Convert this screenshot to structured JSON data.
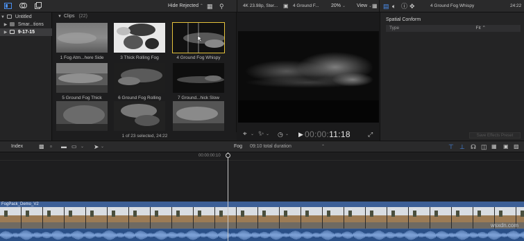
{
  "toolbar": {
    "hide_rejected": "Hide Rejected",
    "format_info": "4K 23.98p, Ster...",
    "project_clip": "4 Ground F...",
    "zoom": "20%",
    "view": "View",
    "inspector_clip": "4 Ground Fog Whispy",
    "inspector_duration": "24:22"
  },
  "libraries": {
    "items": [
      {
        "label": "Untitled",
        "expanded": true
      },
      {
        "label": "Smar...tions",
        "expanded": false
      },
      {
        "label": "9-17-15",
        "expanded": false,
        "selected": true
      }
    ]
  },
  "browser": {
    "title": "Clips",
    "count": "(22)",
    "clips": [
      {
        "label": "1 Fog Atm...here Side"
      },
      {
        "label": "3 Thick Rolling Fog"
      },
      {
        "label": "4 Ground Fog Whispy",
        "selected": true
      },
      {
        "label": "5 Ground Fog Thick"
      },
      {
        "label": "6 Ground Fog Rolling"
      },
      {
        "label": "7 Ground...hick Slow"
      },
      {
        "label": ""
      },
      {
        "label": ""
      },
      {
        "label": ""
      }
    ],
    "status": "1 of 23 selected, 24:22"
  },
  "viewer": {
    "timecode_dim": "00:00:",
    "timecode_lit": "11:18"
  },
  "inspector": {
    "section": "Spatial Conform",
    "row_label": "Type",
    "row_value": "Fit ⌃",
    "button": "Save Effects Preset"
  },
  "timeline_toolbar": {
    "index": "Index",
    "project": "Fog",
    "duration": "09:10 total duration"
  },
  "timeline": {
    "ruler_timecode": "00:00:00:10",
    "clip_name": "FogPack_Demo_V2"
  },
  "watermark": "wsxdn.com",
  "colors": {
    "accent": "#4a8ff0",
    "selection": "#e5c33b",
    "clip": "#3c5f96"
  }
}
